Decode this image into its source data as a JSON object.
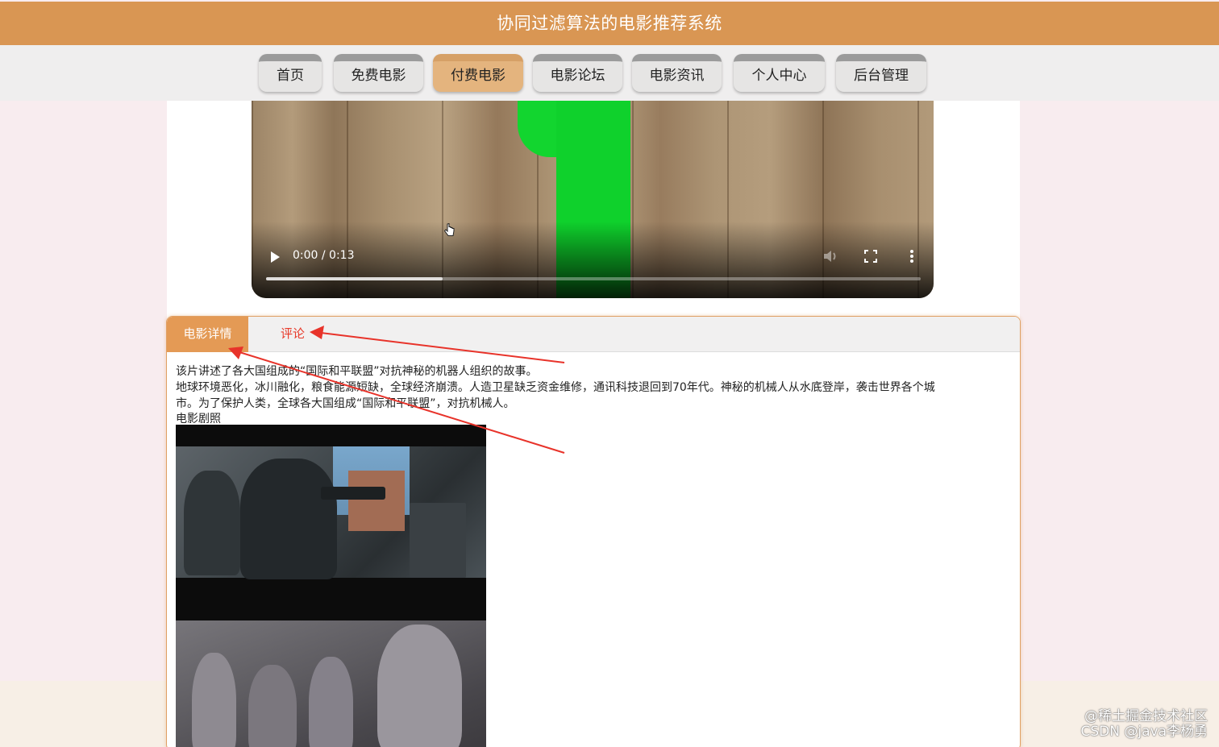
{
  "header": {
    "title": "协同过滤算法的电影推荐系统"
  },
  "nav": {
    "items": [
      {
        "label": "首页"
      },
      {
        "label": "免费电影"
      },
      {
        "label": "付费电影"
      },
      {
        "label": "电影论坛"
      },
      {
        "label": "电影资讯"
      },
      {
        "label": "个人中心"
      },
      {
        "label": "后台管理"
      }
    ],
    "active_index": 2
  },
  "video": {
    "time_display": "0:00 / 0:13",
    "buffered_fraction": 0.27,
    "controls": [
      "play-icon",
      "volume-muted-icon",
      "fullscreen-icon",
      "more-vert-icon"
    ]
  },
  "tabs": {
    "details_label": "电影详情",
    "comments_label": "评论"
  },
  "description": {
    "line1": "该片讲述了各大国组成的“国际和平联盟”对抗神秘的机器人组织的故事。",
    "line2": "地球环境恶化，冰川融化，粮食能源短缺，全球经济崩溃。人造卫星缺乏资金维修，通讯科技退回到70年代。神秘的机械人从水底登岸，袭击世界各个城",
    "line3": "市。为了保护人类，全球各大国组成“国际和平联盟”，对抗机械人。",
    "stills_label": "电影剧照"
  },
  "watermark": {
    "line1": "@稀土掘金技术社区",
    "line2": "CSDN @java李杨勇"
  },
  "colors": {
    "header_bg": "#d99653",
    "nav_active": "#e4b47e",
    "tab_active": "#e49a55",
    "tab_comment_text": "#e83a2a",
    "annotation_arrow": "#e8332a"
  }
}
